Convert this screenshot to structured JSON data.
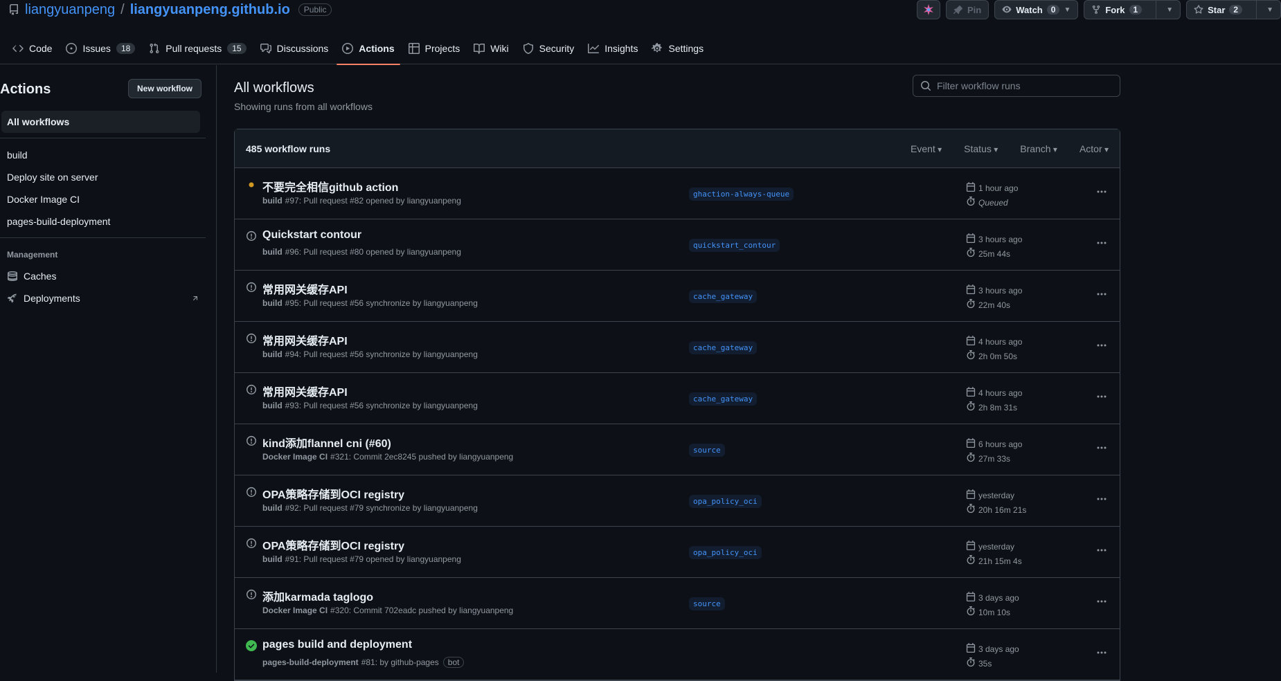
{
  "repo": {
    "owner": "liangyuanpeng",
    "separator": "/",
    "name": "liangyuanpeng.github.io",
    "visibility": "Public"
  },
  "repo_actions": {
    "pin_label": "Pin",
    "watch_label": "Watch",
    "watch_count": "0",
    "fork_label": "Fork",
    "fork_count": "1",
    "star_label": "Star",
    "star_count": "2"
  },
  "nav": {
    "tabs": [
      {
        "label": "Code",
        "icon": "code-icon"
      },
      {
        "label": "Issues",
        "count": "18",
        "icon": "issue-icon"
      },
      {
        "label": "Pull requests",
        "count": "15",
        "icon": "pull-request-icon"
      },
      {
        "label": "Discussions",
        "icon": "discussion-icon"
      },
      {
        "label": "Actions",
        "icon": "play-icon",
        "active": true
      },
      {
        "label": "Projects",
        "icon": "table-icon"
      },
      {
        "label": "Wiki",
        "icon": "book-icon"
      },
      {
        "label": "Security",
        "icon": "shield-icon"
      },
      {
        "label": "Insights",
        "icon": "graph-icon"
      },
      {
        "label": "Settings",
        "icon": "gear-icon"
      }
    ]
  },
  "sidebar": {
    "title": "Actions",
    "new_workflow": "New workflow",
    "all_workflows": "All workflows",
    "workflows": [
      "build",
      "Deploy site on server",
      "Docker Image CI",
      "pages-build-deployment"
    ],
    "management_heading": "Management",
    "management": [
      {
        "label": "Caches",
        "icon": "database-icon"
      },
      {
        "label": "Deployments",
        "icon": "rocket-icon"
      }
    ]
  },
  "main": {
    "title": "All workflows",
    "subtitle": "Showing runs from all workflows",
    "filter_placeholder": "Filter workflow runs",
    "runs_count": "485 workflow runs",
    "filters": [
      "Event",
      "Status",
      "Branch",
      "Actor"
    ]
  },
  "runs": [
    {
      "status": "queued",
      "title": "不要完全相信github action",
      "workflow": "build",
      "detail": "#97: Pull request #82 opened by liangyuanpeng",
      "branch": "ghaction-always-queue",
      "when": "1 hour ago",
      "duration": "Queued"
    },
    {
      "status": "failed",
      "title": "Quickstart contour",
      "workflow": "build",
      "detail": "#96: Pull request #80 opened by liangyuanpeng",
      "branch": "quickstart_contour",
      "when": "3 hours ago",
      "duration": "25m 44s"
    },
    {
      "status": "failed",
      "title": "常用网关缓存API",
      "workflow": "build",
      "detail": "#95: Pull request #56 synchronize by liangyuanpeng",
      "branch": "cache_gateway",
      "when": "3 hours ago",
      "duration": "22m 40s"
    },
    {
      "status": "failed",
      "title": "常用网关缓存API",
      "workflow": "build",
      "detail": "#94: Pull request #56 synchronize by liangyuanpeng",
      "branch": "cache_gateway",
      "when": "4 hours ago",
      "duration": "2h 0m 50s"
    },
    {
      "status": "failed",
      "title": "常用网关缓存API",
      "workflow": "build",
      "detail": "#93: Pull request #56 synchronize by liangyuanpeng",
      "branch": "cache_gateway",
      "when": "4 hours ago",
      "duration": "2h 8m 31s"
    },
    {
      "status": "failed",
      "title": "kind添加flannel cni (#60)",
      "workflow": "Docker Image CI",
      "detail": "#321: Commit 2ec8245 pushed by liangyuanpeng",
      "branch": "source",
      "when": "6 hours ago",
      "duration": "27m 33s"
    },
    {
      "status": "failed",
      "title": "OPA策略存储到OCI registry",
      "workflow": "build",
      "detail": "#92: Pull request #79 synchronize by liangyuanpeng",
      "branch": "opa_policy_oci",
      "when": "yesterday",
      "duration": "20h 16m 21s"
    },
    {
      "status": "failed",
      "title": "OPA策略存储到OCI registry",
      "workflow": "build",
      "detail": "#91: Pull request #79 opened by liangyuanpeng",
      "branch": "opa_policy_oci",
      "when": "yesterday",
      "duration": "21h 15m 4s"
    },
    {
      "status": "failed",
      "title": "添加karmada taglogo",
      "workflow": "Docker Image CI",
      "detail": "#320: Commit 702eadc pushed by liangyuanpeng",
      "branch": "source",
      "when": "3 days ago",
      "duration": "10m 10s"
    },
    {
      "status": "success",
      "title": "pages build and deployment",
      "workflow": "pages-build-deployment",
      "detail": "#81: by github-pages",
      "bot": "bot",
      "branch": "",
      "when": "3 days ago",
      "duration": "35s"
    }
  ],
  "colors": {
    "accent_tab": "#f78166",
    "queued": "#d29922",
    "success": "#3fb950",
    "link": "#4493f8"
  }
}
